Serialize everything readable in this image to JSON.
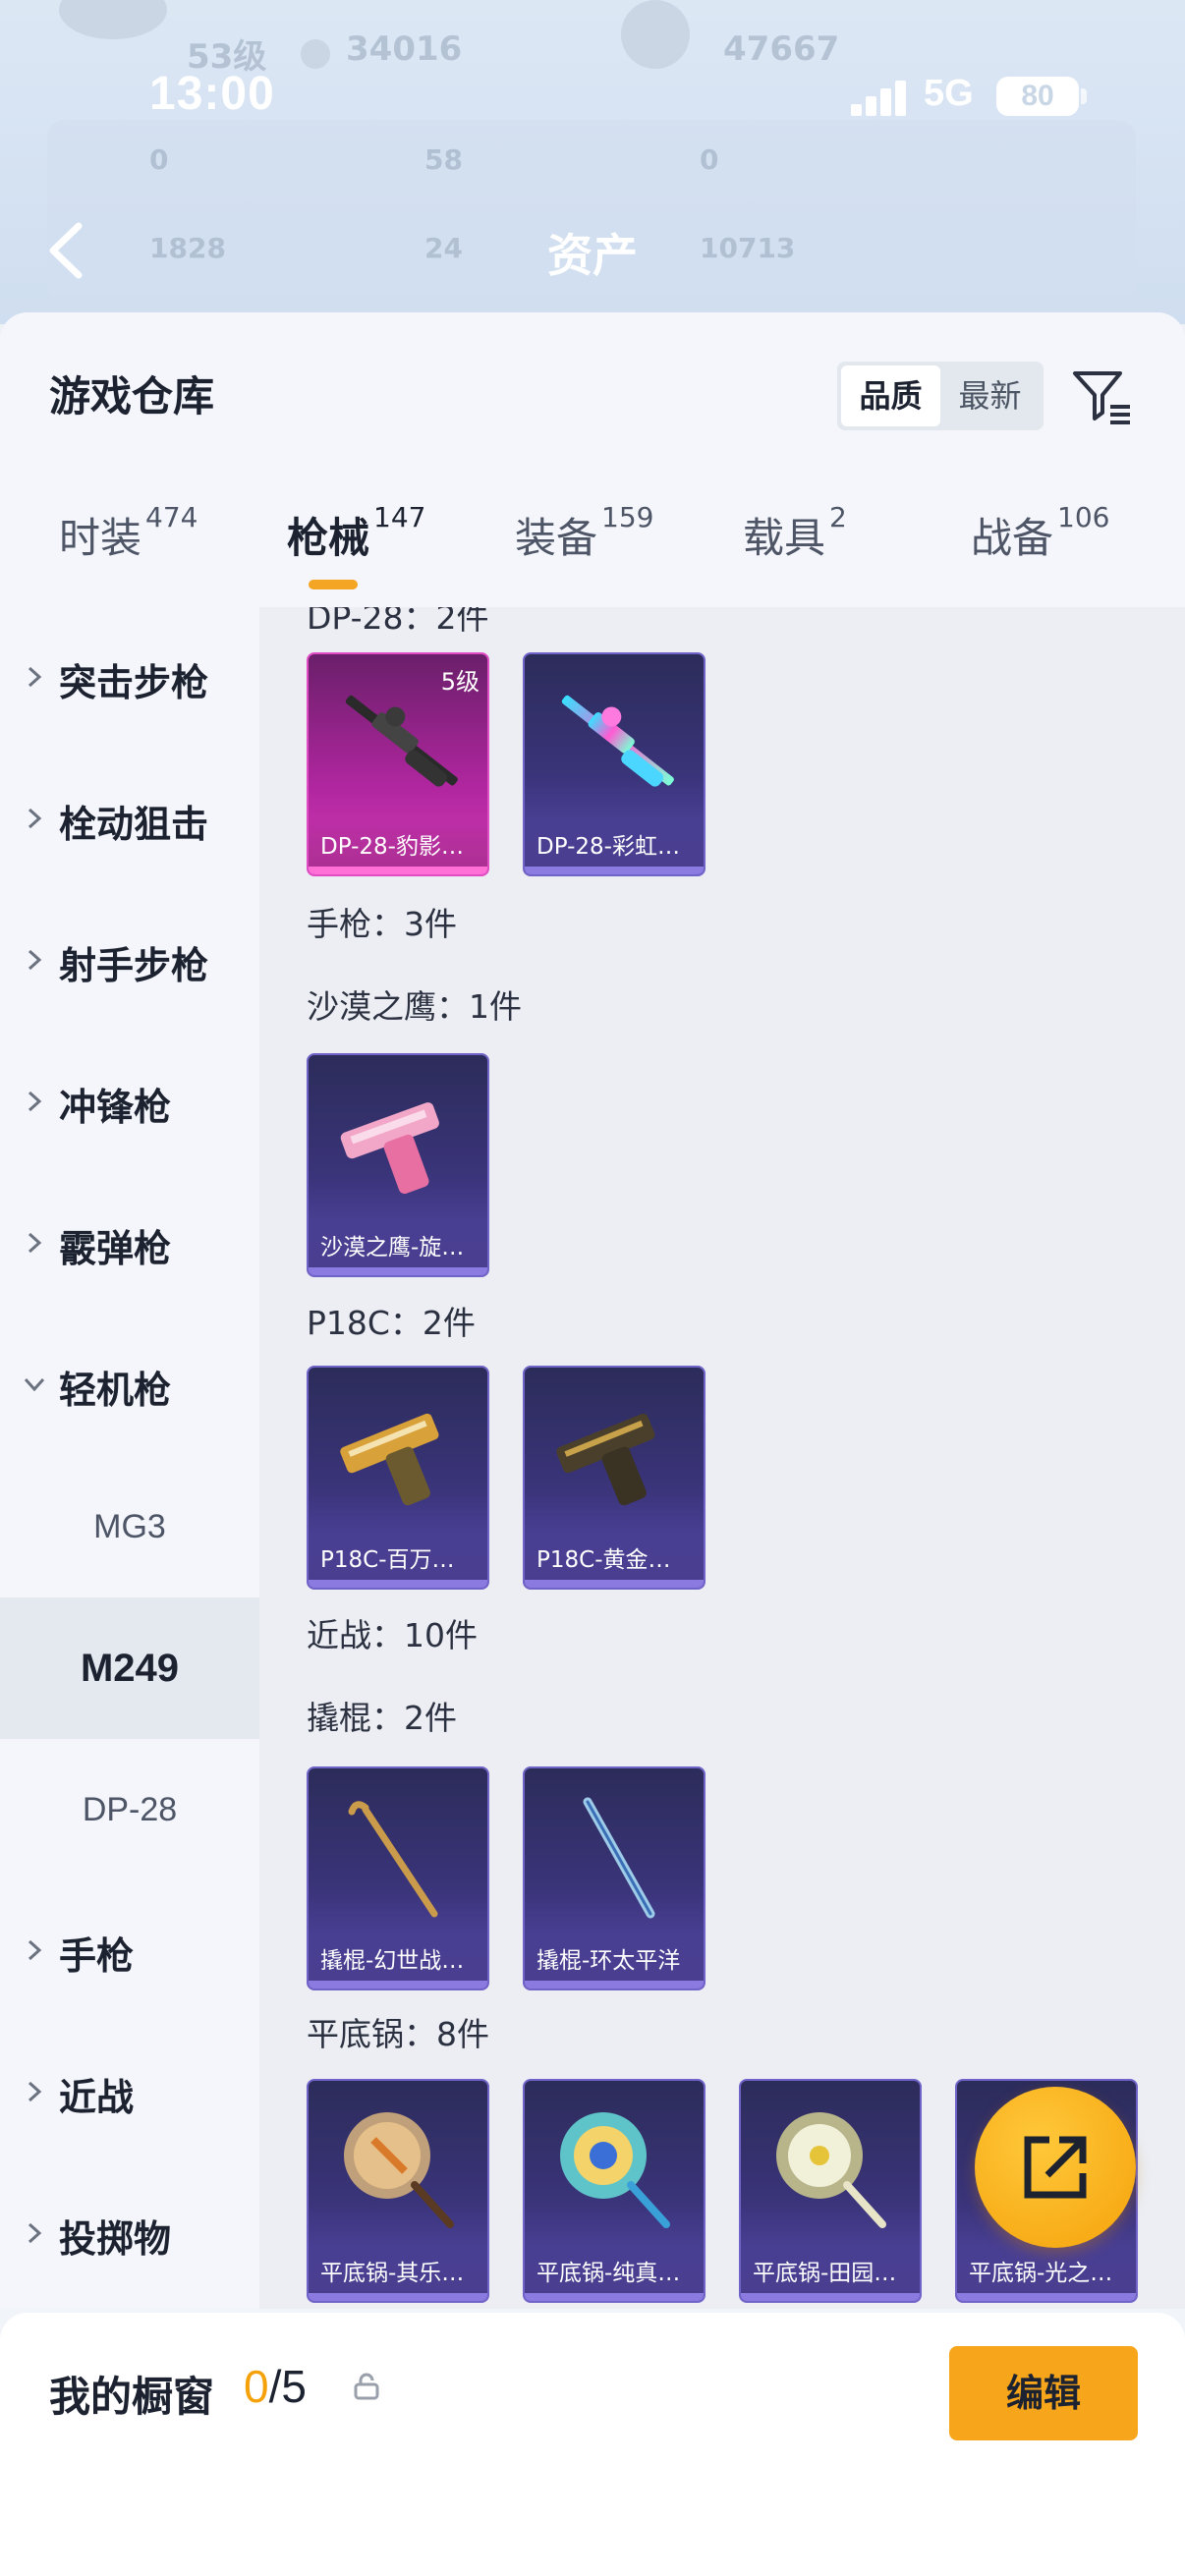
{
  "header_ghost": {
    "level_text": "53级",
    "currency_1": "34016",
    "currency_2": "47667",
    "stats": [
      "0",
      "58",
      "0",
      "1828",
      "24",
      "10713"
    ]
  },
  "status_bar": {
    "time": "13:00",
    "network": "5G",
    "battery": "80"
  },
  "nav": {
    "title": "资产"
  },
  "warehouse": {
    "title": "游戏仓库",
    "sort_options": [
      {
        "label": "品质",
        "active": true
      },
      {
        "label": "最新",
        "active": false
      }
    ],
    "tabs": [
      {
        "label": "时装",
        "count": "474",
        "active": false
      },
      {
        "label": "枪械",
        "count": "147",
        "active": true
      },
      {
        "label": "装备",
        "count": "159",
        "active": false
      },
      {
        "label": "载具",
        "count": "2",
        "active": false
      },
      {
        "label": "战备",
        "count": "106",
        "active": false
      }
    ]
  },
  "sidebar": {
    "items": [
      {
        "label": "突击步枪",
        "expanded": false
      },
      {
        "label": "栓动狙击",
        "expanded": false
      },
      {
        "label": "射手步枪",
        "expanded": false
      },
      {
        "label": "冲锋枪",
        "expanded": false
      },
      {
        "label": "霰弹枪",
        "expanded": false
      },
      {
        "label": "轻机枪",
        "expanded": true
      }
    ],
    "sub_items": [
      {
        "label": "MG3",
        "selected": false
      },
      {
        "label": "M249",
        "selected": true
      },
      {
        "label": "DP-28",
        "selected": false
      }
    ],
    "items_after": [
      {
        "label": "手枪",
        "expanded": false
      },
      {
        "label": "近战",
        "expanded": false
      },
      {
        "label": "投掷物",
        "expanded": false
      }
    ]
  },
  "content": {
    "groups": [
      {
        "label": "DP-28：2件"
      },
      {
        "label": "手枪：3件"
      },
      {
        "label": "沙漠之鹰：1件"
      },
      {
        "label": "P18C：2件"
      },
      {
        "label": "近战：10件"
      },
      {
        "label": "撬棍：2件"
      },
      {
        "label": "平底锅：8件"
      }
    ],
    "cards": [
      {
        "name": "DP-28-豹影…",
        "tier": "5级",
        "style": "pink",
        "icon": "machine-gun-icon"
      },
      {
        "name": "DP-28-彩虹…",
        "tier": "",
        "style": "purple",
        "icon": "machine-gun-icon"
      },
      {
        "name": "沙漠之鹰-旋…",
        "tier": "",
        "style": "purple",
        "icon": "pistol-icon"
      },
      {
        "name": "P18C-百万…",
        "tier": "",
        "style": "purple",
        "icon": "pistol-icon"
      },
      {
        "name": "P18C-黄金…",
        "tier": "",
        "style": "purple",
        "icon": "pistol-icon"
      },
      {
        "name": "撬棍-幻世战…",
        "tier": "",
        "style": "purple",
        "icon": "crowbar-icon"
      },
      {
        "name": "撬棍-环太平洋",
        "tier": "",
        "style": "purple",
        "icon": "crowbar-icon"
      },
      {
        "name": "平底锅-其乐…",
        "tier": "",
        "style": "purple",
        "icon": "pan-icon"
      },
      {
        "name": "平底锅-纯真…",
        "tier": "",
        "style": "purple",
        "icon": "pan-icon"
      },
      {
        "name": "平底锅-田园…",
        "tier": "",
        "style": "purple",
        "icon": "pan-icon"
      },
      {
        "name": "平底锅-光之…",
        "tier": "",
        "style": "purple",
        "icon": "pan-icon"
      }
    ]
  },
  "showcase": {
    "title": "我的橱窗",
    "used": "0",
    "total": "/5",
    "edit_label": "编辑"
  },
  "colors": {
    "accent": "#f5a524",
    "rarity_purple": "#6f63c8",
    "rarity_pink": "#e04cc4"
  }
}
